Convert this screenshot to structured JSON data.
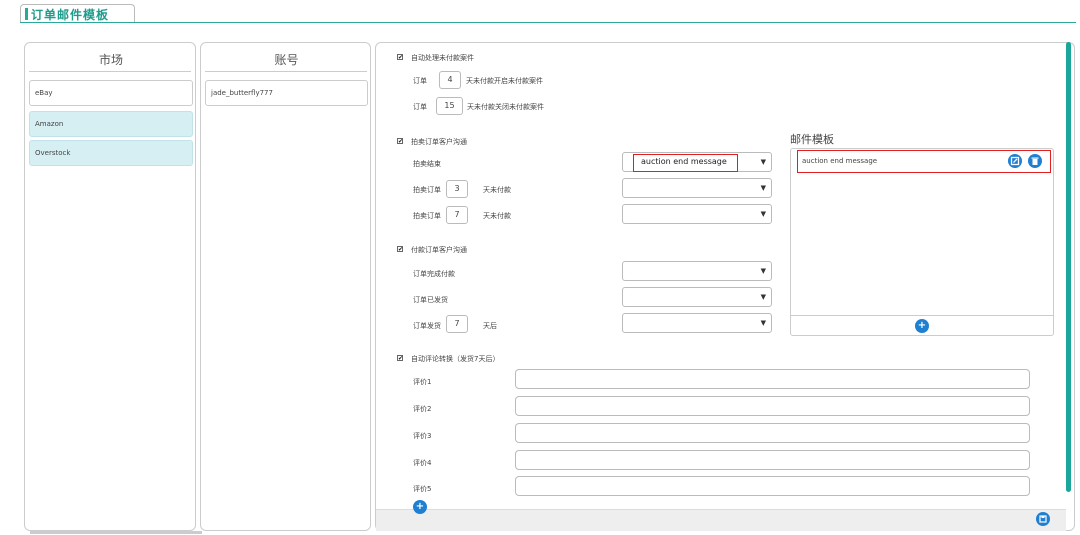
{
  "page": {
    "title": "订单邮件模板"
  },
  "market": {
    "header": "市场",
    "items": [
      "eBay",
      "Amazon",
      "Overstock"
    ]
  },
  "account": {
    "header": "账号",
    "items": [
      "jade_butterfly777"
    ]
  },
  "unpaid": {
    "checkbox_label": "自动处理未付款案件",
    "open_prefix": "订单",
    "open_days": "4",
    "open_suffix": "天未付款开启未付款案件",
    "close_prefix": "订单",
    "close_days": "15",
    "close_suffix": "天未付款关闭未付款案件"
  },
  "auction_comm": {
    "checkbox_label": "拍卖订单客户沟通",
    "end_label": "拍卖结束",
    "end_value": "auction end message",
    "row2_prefix": "拍卖订单",
    "row2_days": "3",
    "row2_suffix": "天未付款",
    "row3_prefix": "拍卖订单",
    "row3_days": "7",
    "row3_suffix": "天未付款"
  },
  "paid_comm": {
    "checkbox_label": "付款订单客户沟通",
    "complete_label": "订单完成付款",
    "shipped_label": "订单已发货",
    "after_prefix": "订单发货",
    "after_days": "7",
    "after_suffix": "天后"
  },
  "review": {
    "checkbox_label": "自动评论转换（发货7天后）",
    "labels": [
      "评价1",
      "评价2",
      "评价3",
      "评价4",
      "评价5"
    ]
  },
  "templates": {
    "title": "邮件模板",
    "items": [
      "auction end message"
    ]
  },
  "colors": {
    "accent": "#2aa89a",
    "highlight": "#e02020",
    "selected": "#d6eff2",
    "button": "#1f7fd1"
  },
  "icons": {
    "edit": "edit-icon",
    "delete": "trash-icon",
    "add": "plus-icon",
    "save": "save-icon",
    "dropdown": "chevron-down-icon"
  }
}
